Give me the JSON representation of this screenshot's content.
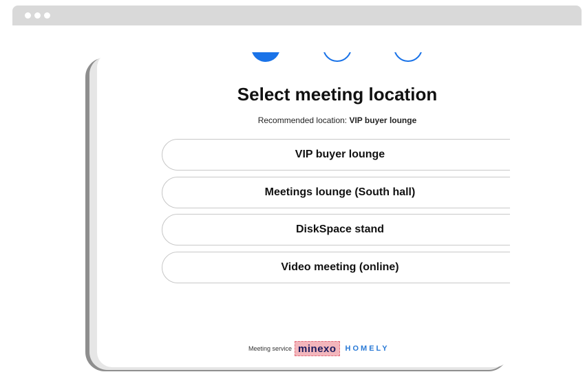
{
  "window": {
    "controls": [
      "close",
      "minimize",
      "maximize"
    ]
  },
  "steps": [
    {
      "state": "active"
    },
    {
      "state": "inactive"
    },
    {
      "state": "inactive"
    }
  ],
  "page": {
    "title": "Select meeting location",
    "recommended_prefix": "Recommended location: ",
    "recommended_value": "VIP buyer lounge"
  },
  "options": [
    {
      "label": "VIP buyer lounge"
    },
    {
      "label": "Meetings lounge (South hall)"
    },
    {
      "label": "DiskSpace stand"
    },
    {
      "label": "Video meeting (online)"
    }
  ],
  "footer": {
    "label": "Meeting service",
    "brand_primary": "minexo",
    "brand_secondary": "HOMELY"
  },
  "colors": {
    "accent": "#1a73e8",
    "brand_primary_bg": "#f3b6bc",
    "brand_secondary": "#2a7ad6"
  }
}
